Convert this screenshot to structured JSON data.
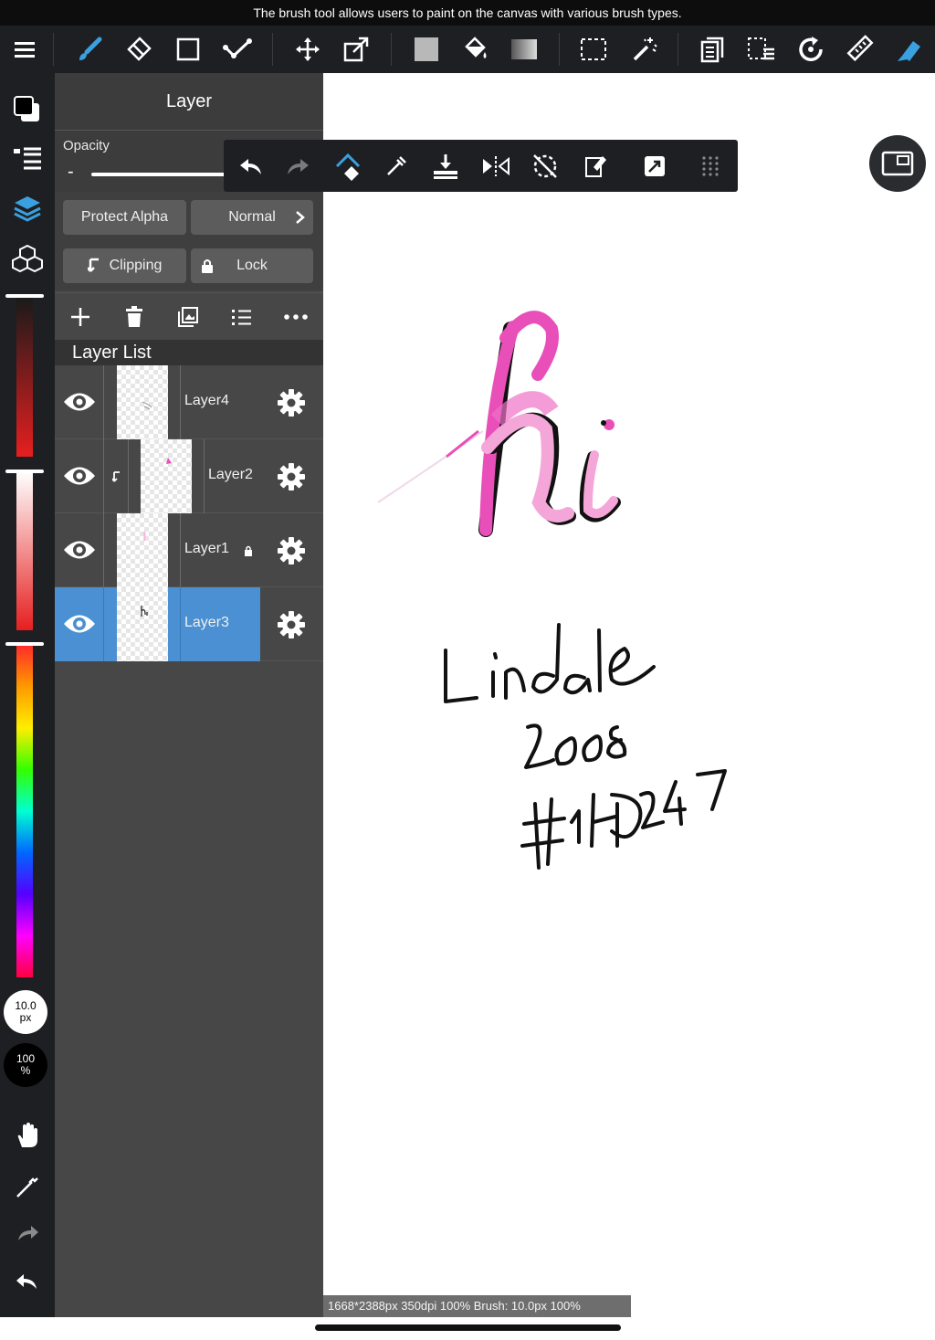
{
  "tooltip": "The brush tool allows users to paint on the canvas with various brush types.",
  "toolbar": {
    "tools": [
      "menu-icon",
      "brush-icon",
      "eraser-icon",
      "rectangle-icon",
      "dot-line-icon",
      "move-icon",
      "transform-icon",
      "fill-color-icon",
      "bucket-icon",
      "gradient-icon",
      "select-rect-icon",
      "magic-wand-icon",
      "layer-copy-icon",
      "select-layer-icon",
      "rotate-icon",
      "ruler-icon",
      "pen-icon"
    ],
    "accent": "#3aa0e0"
  },
  "panel": {
    "title": "Layer",
    "opacity_label": "Opacity",
    "opacity_minus": "-",
    "protect_alpha": "Protect Alpha",
    "blend_mode": "Normal",
    "clipping": "Clipping",
    "lock": "Lock",
    "list_header": "Layer List",
    "layers": [
      {
        "name": "Layer4",
        "visible": true,
        "locked": false,
        "clipped": false,
        "selected": false
      },
      {
        "name": "Layer2",
        "visible": true,
        "locked": false,
        "clipped": true,
        "selected": false
      },
      {
        "name": "Layer1",
        "visible": true,
        "locked": true,
        "clipped": false,
        "selected": false
      },
      {
        "name": "Layer3",
        "visible": true,
        "locked": false,
        "clipped": false,
        "selected": true
      }
    ],
    "selected_color": "#4a90d2"
  },
  "leftbar": {
    "brush_size_value": "10.0",
    "brush_size_unit": "px",
    "brush_opacity_value": "100",
    "brush_opacity_unit": "%"
  },
  "status": "1668*2388px 350dpi 100% Brush: 10.0px 100%",
  "canvas": {
    "ink_pink": "#e84fb8",
    "ink_dark": "#111111"
  }
}
